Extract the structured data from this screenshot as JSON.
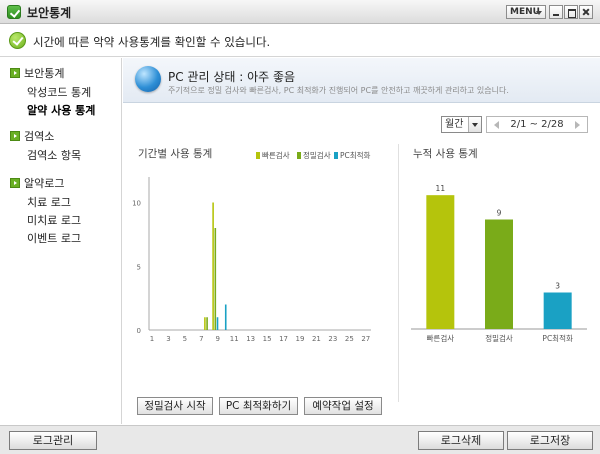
{
  "window": {
    "title": "보안통계",
    "menu_label": "MENU"
  },
  "notice": {
    "text": "시간에 따른 악약 사용통계를 확인할 수 있습니다."
  },
  "sidebar": {
    "groups": [
      {
        "label": "보안통계",
        "items": [
          "악성코드 통계",
          "알약 사용 통계"
        ]
      },
      {
        "label": "검역소",
        "items": [
          "검역소 항목"
        ]
      },
      {
        "label": "알약로그",
        "items": [
          "치료 로그",
          "미치료 로그",
          "이벤트 로그"
        ]
      }
    ],
    "active_item": "알약 사용 통계"
  },
  "status": {
    "title": "PC 관리 상태 : 아주 좋음",
    "description": "주기적으로 정밀 검사와 빠른검사, PC 최적화가 진행되어 PC를 안전하고 깨끗하게 관리하고 있습니다."
  },
  "controls": {
    "period_selected": "월간",
    "range": "2/1 ~ 2/28"
  },
  "colors": {
    "quick": "#b5c40c",
    "full": "#7aab19",
    "optimize": "#1aa1c4",
    "accent": "#6ab023"
  },
  "chart_data": [
    {
      "type": "bar",
      "title": "기간별 사용 통계",
      "legend": "top-right",
      "series": [
        {
          "name": "빠른검사",
          "x": [
            8,
            9
          ],
          "values": [
            1,
            10
          ]
        },
        {
          "name": "정밀검사",
          "x": [
            8,
            9
          ],
          "values": [
            1,
            8
          ]
        },
        {
          "name": "PC최적화",
          "x": [
            9,
            10
          ],
          "values": [
            1,
            2
          ]
        }
      ],
      "x_ticks": [
        "1",
        "3",
        "5",
        "7",
        "9",
        "11",
        "13",
        "15",
        "17",
        "19",
        "21",
        "23",
        "25",
        "27"
      ],
      "xlim": [
        1,
        28
      ],
      "y_ticks": [
        "0",
        "5",
        "10"
      ],
      "ylim": [
        0,
        12
      ]
    },
    {
      "type": "bar",
      "title": "누적 사용 통계",
      "categories": [
        "빠른검사",
        "정밀검사",
        "PC최적화"
      ],
      "values": [
        11,
        9,
        3
      ],
      "ylim": [
        0,
        12
      ]
    }
  ],
  "buttons": {
    "scan": "정밀검사 시작",
    "optimize": "PC 최적화하기",
    "schedule": "예약작업 설정"
  },
  "footer": {
    "log_manage": "로그관리",
    "log_delete": "로그삭제",
    "log_save": "로그저장"
  }
}
